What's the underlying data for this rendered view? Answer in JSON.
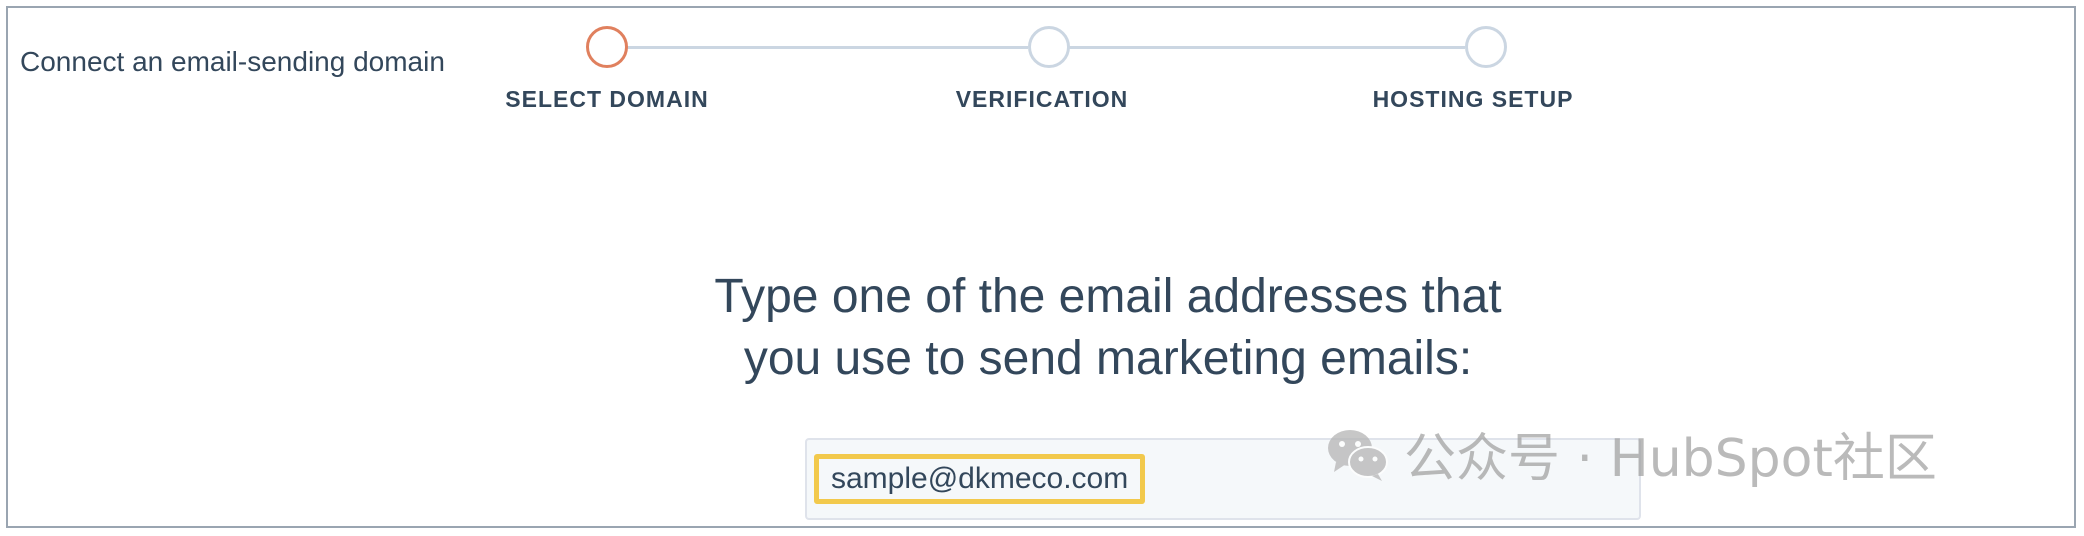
{
  "page": {
    "title": "Connect an email-sending domain"
  },
  "stepper": {
    "steps": [
      {
        "label": "SELECT DOMAIN",
        "state": "active"
      },
      {
        "label": "VERIFICATION",
        "state": "pending"
      },
      {
        "label": "HOSTING SETUP",
        "state": "pending"
      }
    ]
  },
  "main": {
    "headline_line1": "Type one of the email addresses that",
    "headline_line2": "you use to send marketing emails:",
    "email_input": {
      "value": "sample@dkmeco.com"
    }
  },
  "watermark": {
    "icon": "wechat-icon",
    "text": "公众号 · HubSpot社区"
  },
  "colors": {
    "active_step": "#e0805e",
    "inactive_step": "#cbd6e2",
    "highlight": "#f2c94c",
    "text": "#33475b"
  }
}
